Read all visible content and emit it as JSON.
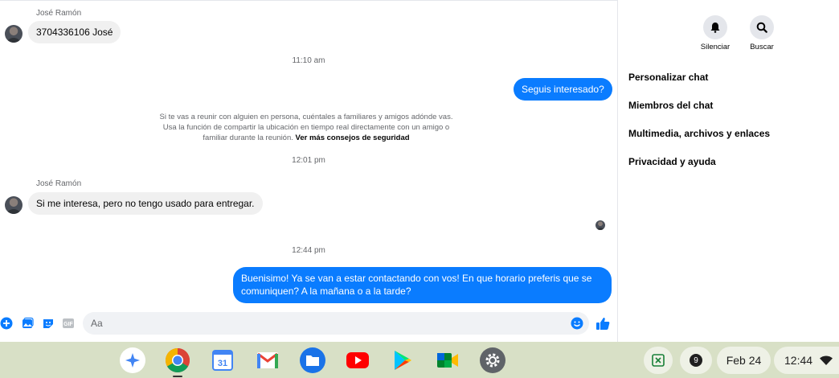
{
  "chat": {
    "messages": [
      {
        "sender": "José Ramón",
        "text": "3704336106 José"
      },
      {
        "time": "11:10 am"
      },
      {
        "text": "Seguis interesado?"
      },
      {
        "notice": "Si te vas a reunir con alguien en persona, cuéntales a familiares y amigos adónde vas. Usa la función de compartir la ubicación en tiempo real directamente con un amigo o familiar durante la reunión.",
        "notice_link": "Ver más consejos de seguridad"
      },
      {
        "time": "12:01 pm"
      },
      {
        "sender": "José Ramón",
        "text": "Si me interesa, pero no tengo usado para entregar."
      },
      {
        "time": "12:44 pm"
      },
      {
        "text": "Buenisimo! Ya se van a estar contactando con vos! En que horario preferis que se comuniquen? A la mañana o a la tarde?"
      }
    ],
    "composer": {
      "placeholder": "Aa",
      "icons": [
        "plus-icon",
        "photo-icon",
        "sticker-icon",
        "gif-icon",
        "emoji-icon",
        "like-icon"
      ]
    }
  },
  "side": {
    "buttons": [
      {
        "label": "Silenciar",
        "icon": "bell-icon"
      },
      {
        "label": "Buscar",
        "icon": "search-icon"
      }
    ],
    "menu": [
      "Personalizar chat",
      "Miembros del chat",
      "Multimedia, archivos y enlaces",
      "Privacidad y ayuda"
    ]
  },
  "shelf": {
    "apps": [
      "launcher-icon",
      "chrome-icon",
      "calendar-icon",
      "gmail-icon",
      "files-icon",
      "youtube-icon",
      "play-store-icon",
      "meet-icon",
      "settings-icon"
    ],
    "calendar_day": "31",
    "status": {
      "notification_count": "9",
      "date": "Feb 24",
      "time": "12:44"
    }
  },
  "colors": {
    "accent": "#0a7cff",
    "incoming_bubble": "#f0f0f0",
    "shelf": "#d8e0c6"
  }
}
